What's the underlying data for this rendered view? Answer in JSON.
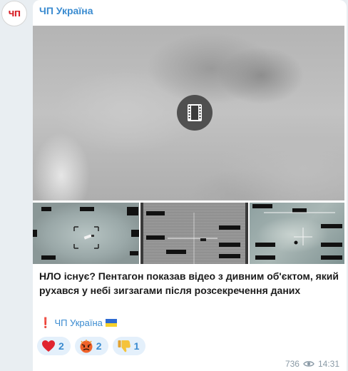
{
  "avatar": {
    "text": "ЧП",
    "color": "#d8232a"
  },
  "channel": {
    "name": "ЧП Україна",
    "color": "#3a8bd0"
  },
  "media": {
    "video_icon": "film-icon"
  },
  "caption": "НЛО існує? Пентагон показав відео з дивним об'єктом, який рухався у небі зигзагами після розсекречення даних",
  "signature": {
    "prefix": "❗",
    "text": "ЧП Україна"
  },
  "reactions": [
    {
      "icon": "heart-icon",
      "count": "2"
    },
    {
      "icon": "angry-face-icon",
      "count": "2"
    },
    {
      "icon": "thumbs-down-icon",
      "count": "1"
    }
  ],
  "meta": {
    "views": "736",
    "time": "14:31",
    "views_icon": "eye-icon"
  }
}
